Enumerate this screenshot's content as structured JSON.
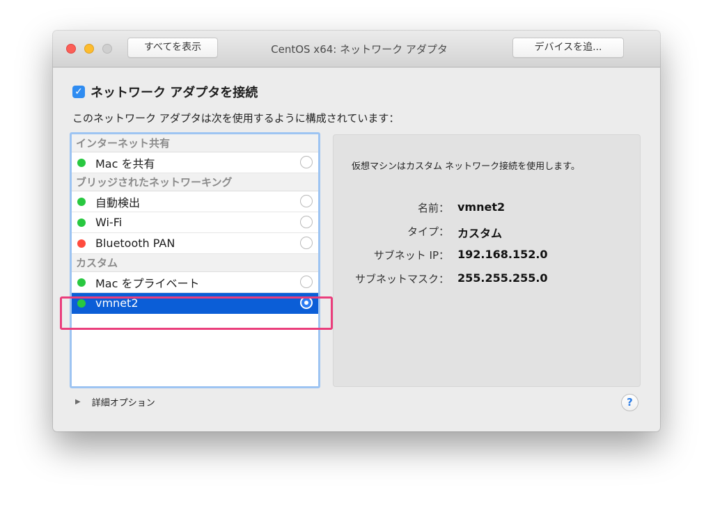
{
  "window": {
    "title": "CentOS x64: ネットワーク アダプタ",
    "show_all_label": "すべてを表示",
    "add_device_label": "デバイスを追..."
  },
  "connect": {
    "checked": true,
    "label": "ネットワーク アダプタを接続"
  },
  "config_description": "このネットワーク アダプタは次を使用するように構成されています：",
  "network_list": {
    "groups": [
      {
        "header": "インターネット共有",
        "items": [
          {
            "label": "Mac を共有",
            "status_color": "#28c840",
            "selected": false
          }
        ]
      },
      {
        "header": "ブリッジされたネットワーキング",
        "items": [
          {
            "label": "自動検出",
            "status_color": "#28c840",
            "selected": false
          },
          {
            "label": "Wi-Fi",
            "status_color": "#28c840",
            "selected": false
          },
          {
            "label": "Bluetooth PAN",
            "status_color": "#ff4b3e",
            "selected": false
          }
        ]
      },
      {
        "header": "カスタム",
        "items": [
          {
            "label": "Mac をプライベート",
            "status_color": "#28c840",
            "selected": false
          },
          {
            "label": "vmnet2",
            "status_color": "#28c840",
            "selected": true
          }
        ]
      }
    ]
  },
  "details": {
    "message": "仮想マシンはカスタム ネットワーク接続を使用します。",
    "rows": [
      {
        "label": "名前：",
        "value": "vmnet2"
      },
      {
        "label": "タイプ：",
        "value": "カスタム"
      },
      {
        "label": "サブネット IP：",
        "value": "192.168.152.0"
      },
      {
        "label": "サブネットマスク：",
        "value": "255.255.255.0"
      }
    ]
  },
  "advanced_options_label": "詳細オプション",
  "help_label": "?",
  "colors": {
    "accent": "#2f8cf1",
    "selection": "#0b5ed7",
    "highlight_box": "#ea3e7c"
  },
  "icons": {
    "checkbox": "checkmark-icon",
    "disclosure": "disclosure-triangle-icon",
    "help": "help-icon"
  }
}
